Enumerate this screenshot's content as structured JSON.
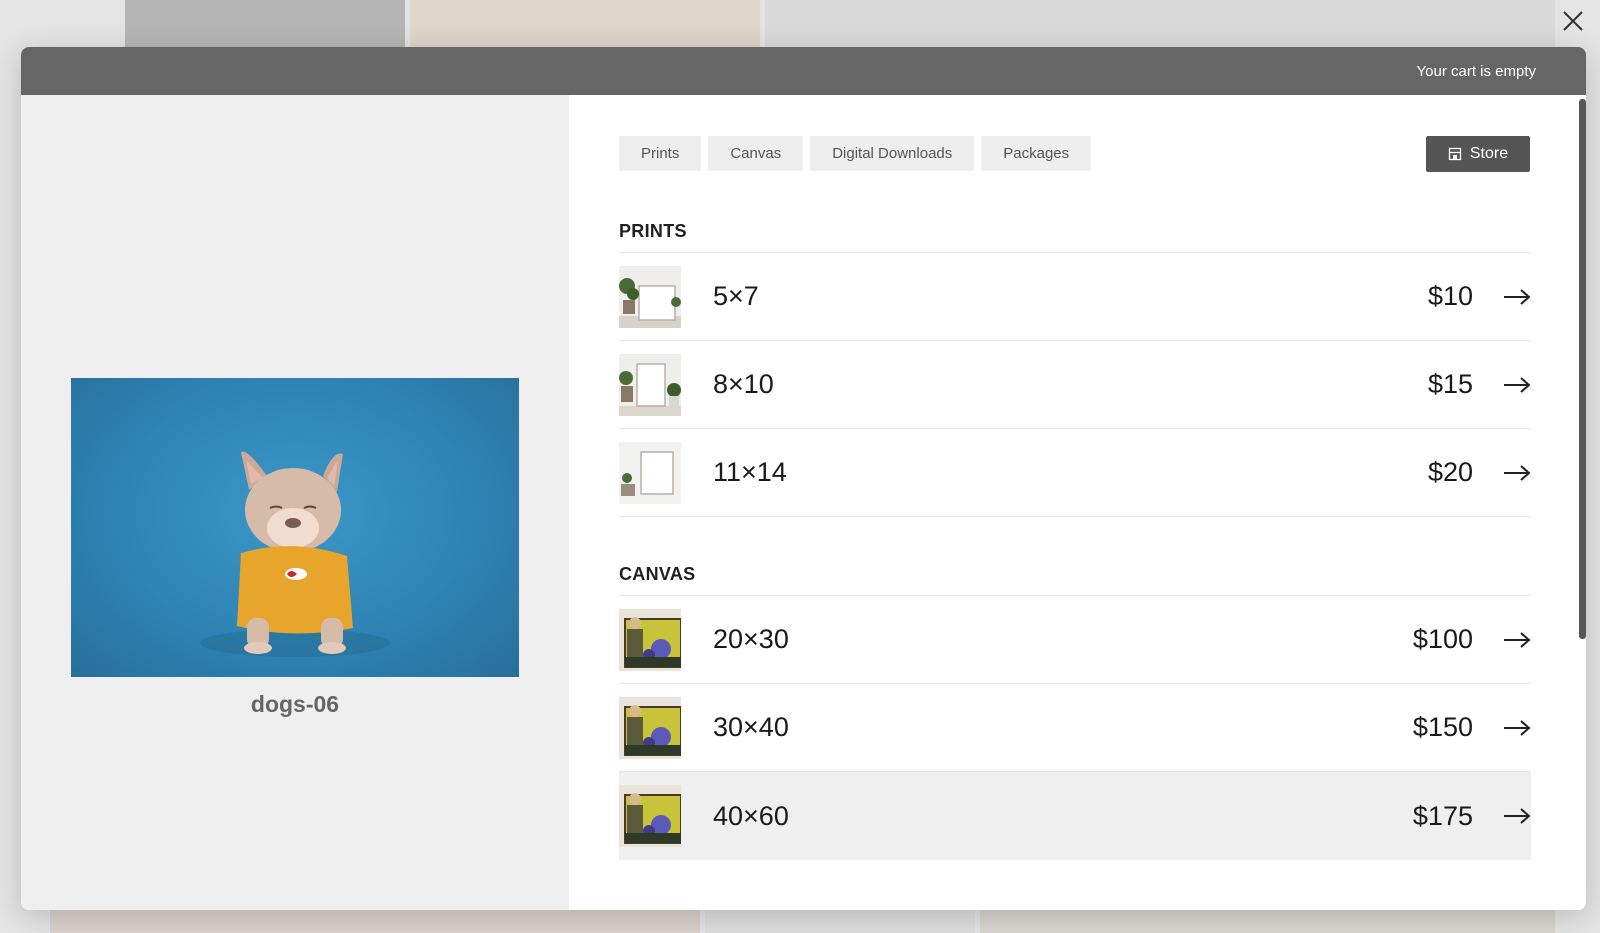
{
  "header": {
    "cart_status": "Your cart is empty"
  },
  "photo": {
    "caption": "dogs-06"
  },
  "tabs": [
    "Prints",
    "Canvas",
    "Digital Downloads",
    "Packages"
  ],
  "store_button": {
    "label": "Store",
    "icon": "store-icon"
  },
  "sections": {
    "prints": {
      "title": "PRINTS",
      "items": [
        {
          "size": "5×7",
          "price": "$10"
        },
        {
          "size": "8×10",
          "price": "$15"
        },
        {
          "size": "11×14",
          "price": "$20"
        }
      ]
    },
    "canvas": {
      "title": "CANVAS",
      "items": [
        {
          "size": "20×30",
          "price": "$100"
        },
        {
          "size": "30×40",
          "price": "$150"
        },
        {
          "size": "40×60",
          "price": "$175"
        }
      ]
    }
  },
  "colors": {
    "header_bg": "#666666",
    "store_button_bg": "#555555",
    "photo_bg": "#2e84b5"
  }
}
